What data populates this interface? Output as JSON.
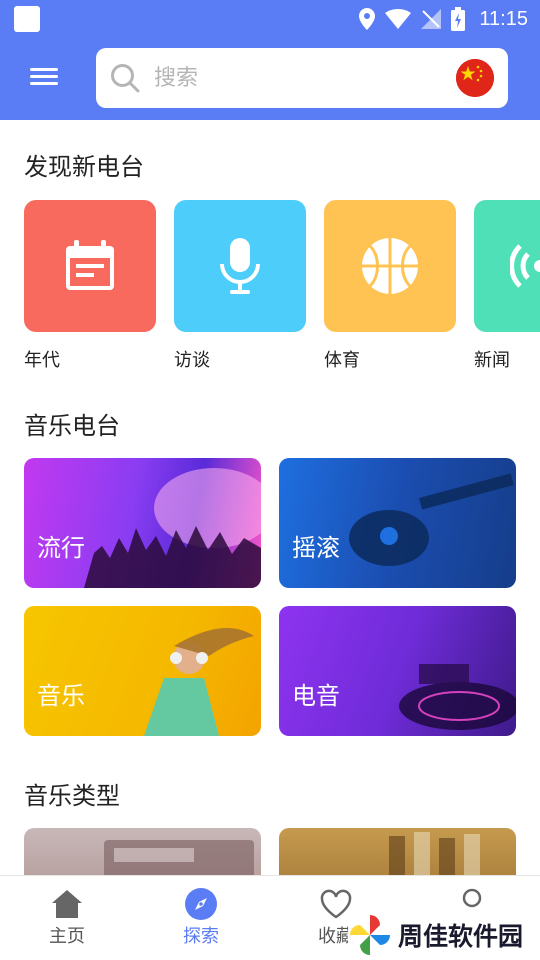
{
  "status_bar": {
    "time": "11:15"
  },
  "search": {
    "placeholder": "搜索"
  },
  "sections": {
    "discover": {
      "title": "发现新电台"
    },
    "music": {
      "title": "音乐电台"
    },
    "genre": {
      "title": "音乐类型"
    }
  },
  "discover_items": [
    {
      "label": "年代",
      "icon": "calendar-icon",
      "color": "#f76a5d"
    },
    {
      "label": "访谈",
      "icon": "microphone-icon",
      "color": "#4dcdfa"
    },
    {
      "label": "体育",
      "icon": "basketball-icon",
      "color": "#ffc353"
    },
    {
      "label": "新闻",
      "icon": "broadcast-icon",
      "color": "#4fe0b8"
    }
  ],
  "music_cards": [
    {
      "label": "流行"
    },
    {
      "label": "摇滚"
    },
    {
      "label": "音乐"
    },
    {
      "label": "电音"
    }
  ],
  "bottom_nav": {
    "home": "主页",
    "explore": "探索",
    "favorites": "收藏",
    "active": "explore"
  },
  "colors": {
    "accent": "#5a7cf5"
  },
  "watermark": {
    "text": "周佳软件园"
  }
}
